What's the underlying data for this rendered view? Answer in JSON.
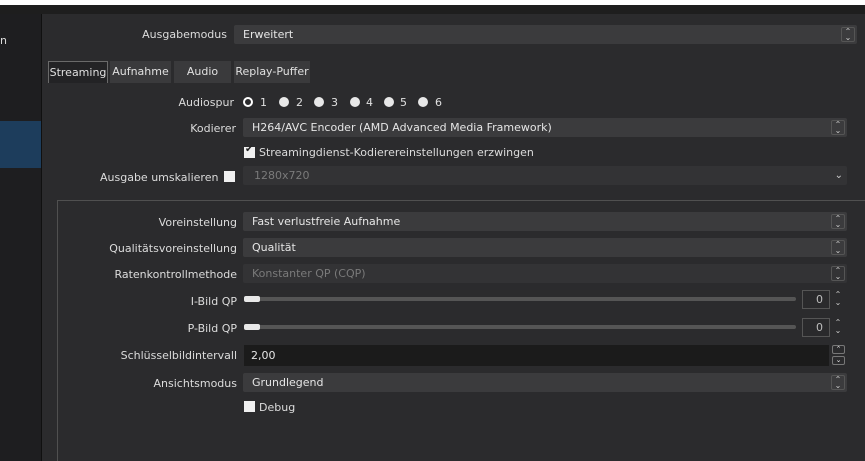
{
  "sidebar": {
    "item_partial": "n"
  },
  "output_mode": {
    "label": "Ausgabemodus",
    "value": "Erweitert"
  },
  "tabs": [
    {
      "label": "Streaming",
      "active": true
    },
    {
      "label": "Aufnahme"
    },
    {
      "label": "Audio"
    },
    {
      "label": "Replay-Puffer"
    }
  ],
  "audiospur": {
    "label": "Audiospur",
    "options": [
      "1",
      "2",
      "3",
      "4",
      "5",
      "6"
    ],
    "selected": "1"
  },
  "kodierer": {
    "label": "Kodierer",
    "value": "H264/AVC Encoder (AMD Advanced Media Framework)"
  },
  "enforce": {
    "label": "Streamingdienst-Kodierereinstellungen erzwingen",
    "checked": true
  },
  "rescale": {
    "label": "Ausgabe umskalieren",
    "value": "1280x720",
    "checked": false
  },
  "voreinstellung": {
    "label": "Voreinstellung",
    "value": "Fast verlustfreie Aufnahme"
  },
  "qualitaet": {
    "label": "Qualitätsvoreinstellung",
    "value": "Qualität"
  },
  "ratenkontrolle": {
    "label": "Ratenkontrollmethode",
    "value": "Konstanter QP (CQP)"
  },
  "ibild": {
    "label": "I-Bild QP",
    "value": "0"
  },
  "pbild": {
    "label": "P-Bild QP",
    "value": "0"
  },
  "keyframe": {
    "label": "Schlüsselbildintervall",
    "value": "2,00"
  },
  "ansicht": {
    "label": "Ansichtsmodus",
    "value": "Grundlegend"
  },
  "debug": {
    "label": "Debug",
    "checked": false
  }
}
